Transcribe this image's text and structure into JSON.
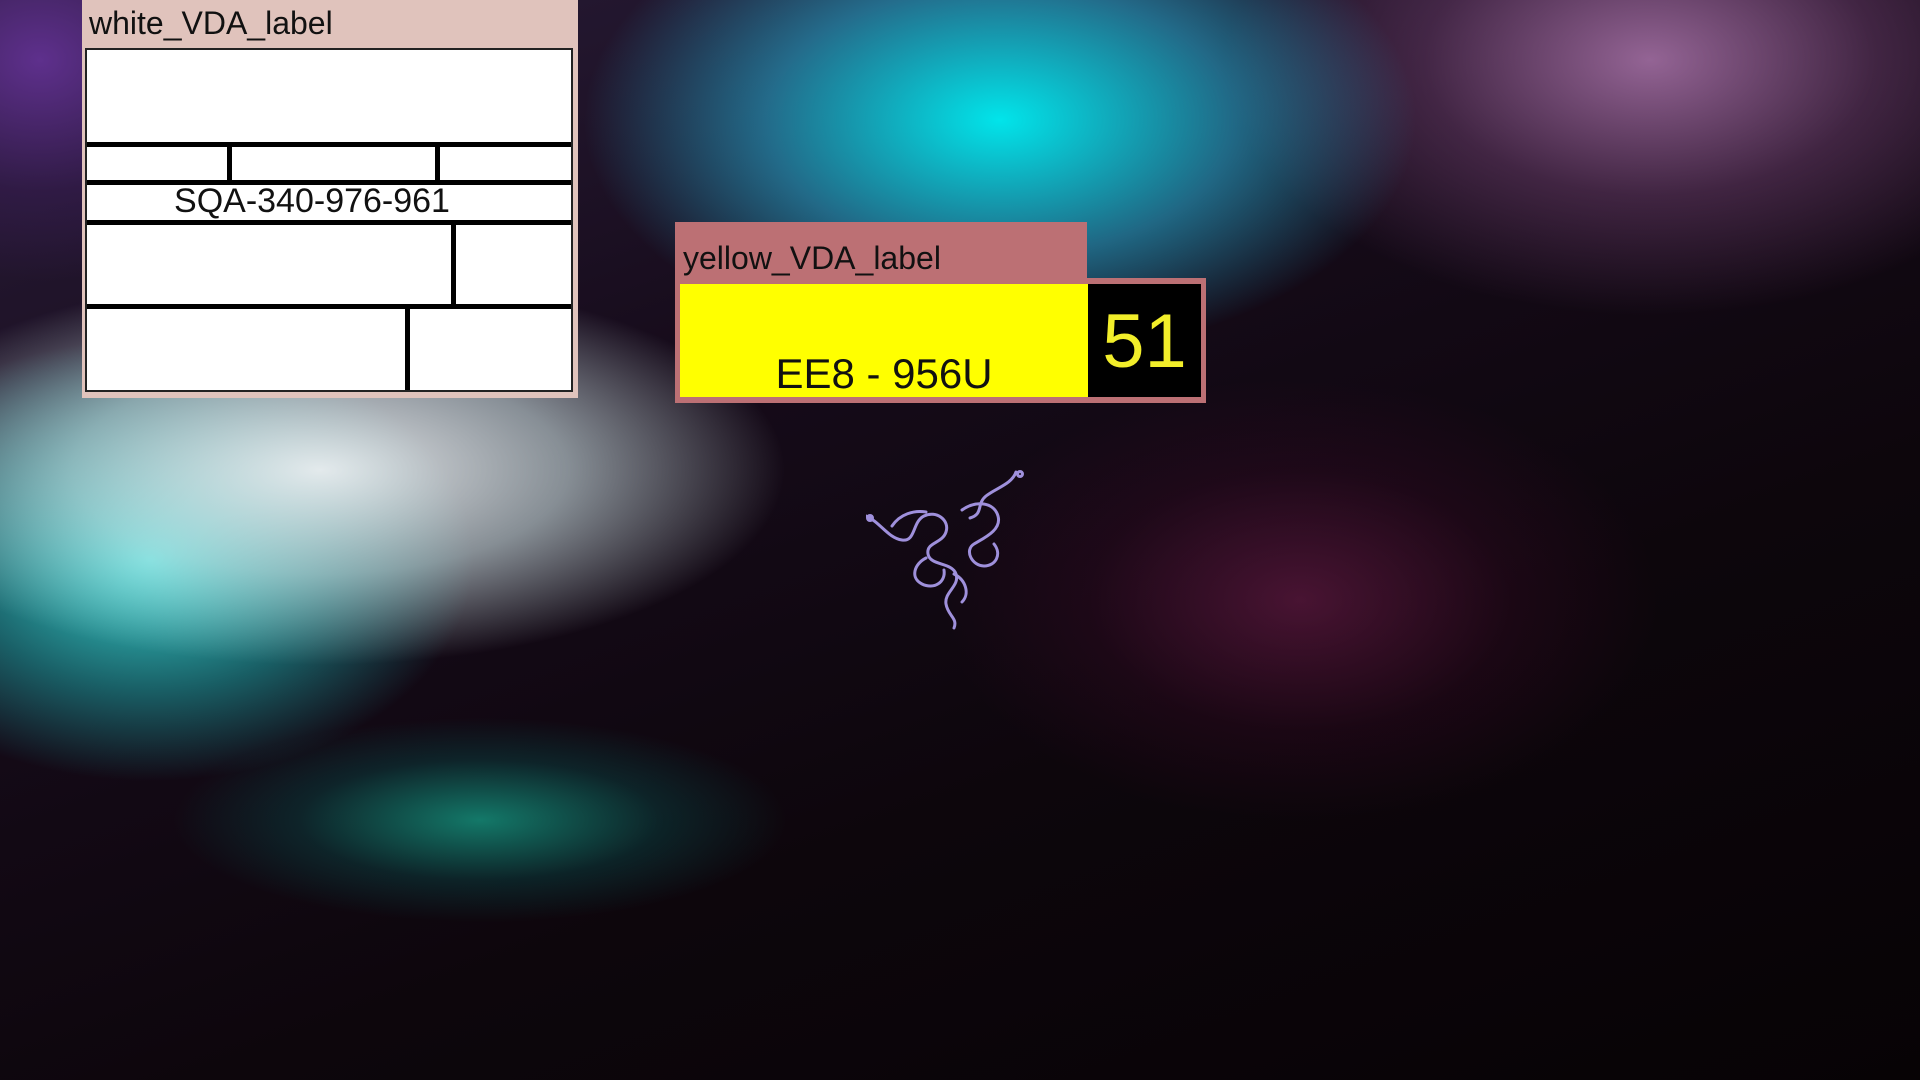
{
  "desktop": {
    "logo_icon": "razer-snake-logo-icon"
  },
  "white_label_window": {
    "title": "white_VDA_label",
    "label_code": "SQA-340-976-961",
    "background_color": "#ffffff",
    "titlebar_color": "#e0c3bc"
  },
  "yellow_label_window": {
    "title": "yellow_VDA_label",
    "plate_text": "EE8 - 956U",
    "number": "51",
    "plate_color": "#ffff00",
    "number_box_color": "#000000",
    "number_color": "#f2ee2a",
    "titlebar_color": "#bc7074"
  }
}
